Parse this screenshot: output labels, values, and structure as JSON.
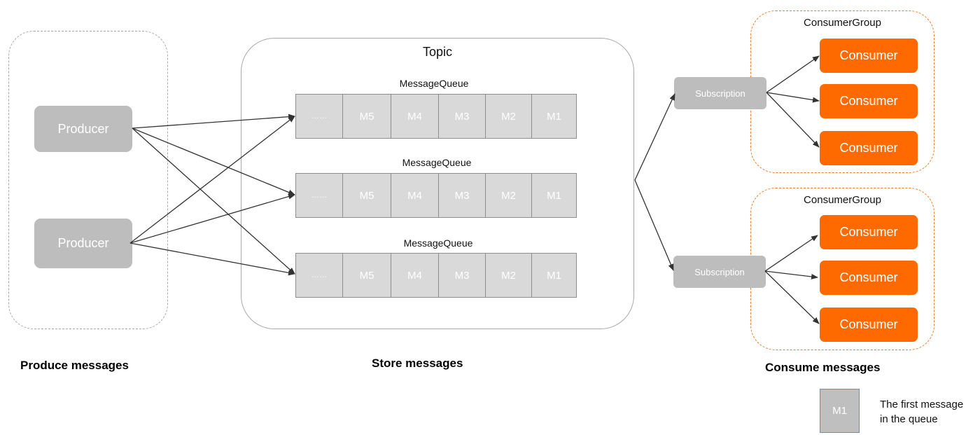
{
  "producers": [
    {
      "label": "Producer"
    },
    {
      "label": "Producer"
    }
  ],
  "topic": {
    "title": "Topic",
    "queues": [
      {
        "title": "MessageQueue",
        "cells": [
          "……",
          "M5",
          "M4",
          "M3",
          "M2",
          "M1"
        ]
      },
      {
        "title": "MessageQueue",
        "cells": [
          "……",
          "M5",
          "M4",
          "M3",
          "M2",
          "M1"
        ]
      },
      {
        "title": "MessageQueue",
        "cells": [
          "……",
          "M5",
          "M4",
          "M3",
          "M2",
          "M1"
        ]
      }
    ]
  },
  "subscriptions": [
    {
      "label": "Subscription"
    },
    {
      "label": "Subscription"
    }
  ],
  "consumer_groups": [
    {
      "title": "ConsumerGroup",
      "consumers": [
        "Consumer",
        "Consumer",
        "Consumer"
      ]
    },
    {
      "title": "ConsumerGroup",
      "consumers": [
        "Consumer",
        "Consumer",
        "Consumer"
      ]
    }
  ],
  "sections": {
    "produce": "Produce messages",
    "store": "Store messages",
    "consume": "Consume messages"
  },
  "legend": {
    "sample_label": "M1",
    "description_line1": "The first message",
    "description_line2": "in the queue"
  },
  "colors": {
    "consumer": "#ff6a00",
    "group_border": "#f07a25",
    "node_gray": "#bdbdbd",
    "queue_fill": "#d9d9d9",
    "arrow": "#333333"
  },
  "edges": [
    {
      "from": "producer-1",
      "to": "queue-1"
    },
    {
      "from": "producer-1",
      "to": "queue-2"
    },
    {
      "from": "producer-1",
      "to": "queue-3"
    },
    {
      "from": "producer-2",
      "to": "queue-1"
    },
    {
      "from": "producer-2",
      "to": "queue-2"
    },
    {
      "from": "producer-2",
      "to": "queue-3"
    },
    {
      "from": "topic",
      "to": "subscription-1"
    },
    {
      "from": "topic",
      "to": "subscription-2"
    },
    {
      "from": "subscription-1",
      "to": "group-1-consumer-1"
    },
    {
      "from": "subscription-1",
      "to": "group-1-consumer-2"
    },
    {
      "from": "subscription-1",
      "to": "group-1-consumer-3"
    },
    {
      "from": "subscription-2",
      "to": "group-2-consumer-1"
    },
    {
      "from": "subscription-2",
      "to": "group-2-consumer-2"
    },
    {
      "from": "subscription-2",
      "to": "group-2-consumer-3"
    }
  ]
}
